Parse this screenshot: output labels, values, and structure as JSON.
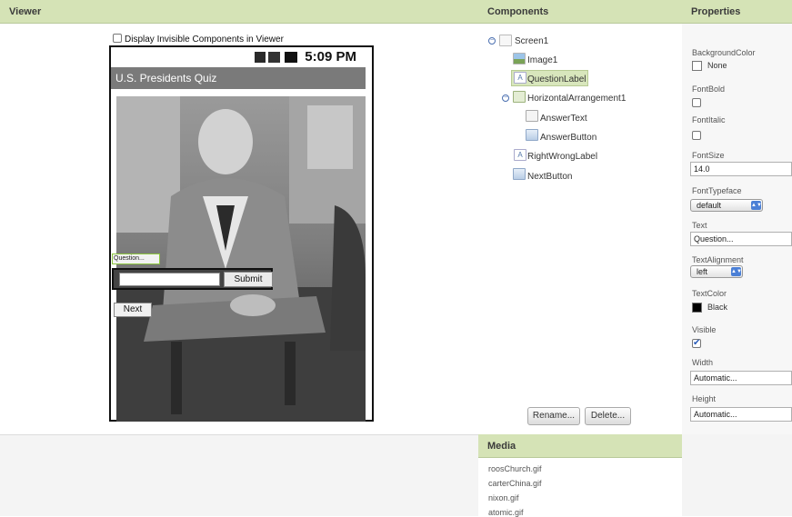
{
  "viewer": {
    "header": "Viewer",
    "display_invisible_label": "Display Invisible Components in Viewer",
    "phone": {
      "clock": "5:09 PM",
      "screen_title": "U.S. Presidents Quiz",
      "question_label": "Question...",
      "answer_button": "Submit",
      "next_button": "Next"
    }
  },
  "components": {
    "header": "Components",
    "tree": [
      {
        "name": "Screen1",
        "icon": "screen-icon"
      },
      {
        "name": "Image1",
        "icon": "image-icon"
      },
      {
        "name": "QuestionLabel",
        "icon": "label-icon",
        "selected": true
      },
      {
        "name": "HorizontalArrangement1",
        "icon": "horizontal-arrangement-icon"
      },
      {
        "name": "AnswerText",
        "icon": "textbox-icon"
      },
      {
        "name": "AnswerButton",
        "icon": "button-icon"
      },
      {
        "name": "RightWrongLabel",
        "icon": "label-icon"
      },
      {
        "name": "NextButton",
        "icon": "button-icon"
      }
    ],
    "rename_button": "Rename...",
    "delete_button": "Delete..."
  },
  "media": {
    "header": "Media",
    "items": [
      "roosChurch.gif",
      "carterChina.gif",
      "nixon.gif",
      "atomic.gif"
    ]
  },
  "properties": {
    "header": "Properties",
    "background_color_label": "BackgroundColor",
    "background_color_value": "None",
    "font_bold_label": "FontBold",
    "font_italic_label": "FontItalic",
    "font_size_label": "FontSize",
    "font_size_value": "14.0",
    "font_typeface_label": "FontTypeface",
    "font_typeface_value": "default",
    "text_label": "Text",
    "text_value": "Question...",
    "text_alignment_label": "TextAlignment",
    "text_alignment_value": "left",
    "text_color_label": "TextColor",
    "text_color_value": "Black",
    "visible_label": "Visible",
    "visible_checked": true,
    "width_label": "Width",
    "width_value": "Automatic...",
    "height_label": "Height",
    "height_value": "Automatic..."
  },
  "colors": {
    "header_bg": "#d5e3b6",
    "selection": "#d8e6bc",
    "accent_blue": "#4a7fd6"
  }
}
